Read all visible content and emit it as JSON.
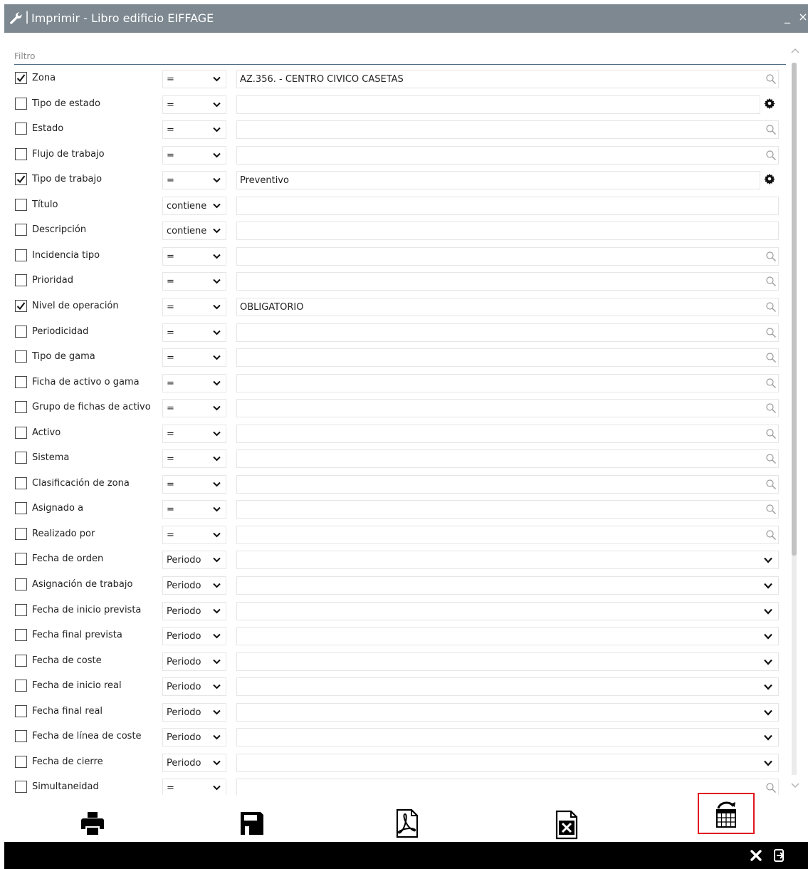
{
  "window": {
    "title": "Imprimir -  Libro edificio EIFFAGE",
    "separator": "|",
    "minimize_label": "_",
    "close_label": "×"
  },
  "filter": {
    "section_label": "Filtro",
    "rows": [
      {
        "label": "Zona",
        "checked": true,
        "operator": "=",
        "value": "AZ.356. - CENTRO CIVICO CASETAS",
        "action": "search-icon"
      },
      {
        "label": "Tipo de estado",
        "checked": false,
        "operator": "=",
        "value": "",
        "action": "gear-icon"
      },
      {
        "label": "Estado",
        "checked": false,
        "operator": "=",
        "value": "",
        "action": "search-icon"
      },
      {
        "label": "Flujo de trabajo",
        "checked": false,
        "operator": "=",
        "value": "",
        "action": "search-icon"
      },
      {
        "label": "Tipo de trabajo",
        "checked": true,
        "operator": "=",
        "value": "Preventivo",
        "action": "gear-icon"
      },
      {
        "label": "Título",
        "checked": false,
        "operator": "contiene",
        "value": "",
        "action": "none"
      },
      {
        "label": "Descripción",
        "checked": false,
        "operator": "contiene",
        "value": "",
        "action": "none"
      },
      {
        "label": "Incidencia tipo",
        "checked": false,
        "operator": "=",
        "value": "",
        "action": "search-icon"
      },
      {
        "label": "Prioridad",
        "checked": false,
        "operator": "=",
        "value": "",
        "action": "search-icon"
      },
      {
        "label": "Nivel de operación",
        "checked": true,
        "operator": "=",
        "value": "OBLIGATORIO",
        "action": "search-icon"
      },
      {
        "label": "Periodicidad",
        "checked": false,
        "operator": "=",
        "value": "",
        "action": "search-icon"
      },
      {
        "label": "Tipo de gama",
        "checked": false,
        "operator": "=",
        "value": "",
        "action": "search-icon"
      },
      {
        "label": "Ficha de activo o gama",
        "checked": false,
        "operator": "=",
        "value": "",
        "action": "search-icon"
      },
      {
        "label": "Grupo de fichas de activo",
        "checked": false,
        "operator": "=",
        "value": "",
        "action": "search-icon"
      },
      {
        "label": "Activo",
        "checked": false,
        "operator": "=",
        "value": "",
        "action": "search-icon"
      },
      {
        "label": "Sistema",
        "checked": false,
        "operator": "=",
        "value": "",
        "action": "search-icon"
      },
      {
        "label": "Clasificación de zona",
        "checked": false,
        "operator": "=",
        "value": "",
        "action": "search-icon"
      },
      {
        "label": "Asignado a",
        "checked": false,
        "operator": "=",
        "value": "",
        "action": "search-icon"
      },
      {
        "label": "Realizado por",
        "checked": false,
        "operator": "=",
        "value": "",
        "action": "search-icon"
      },
      {
        "label": "Fecha de orden",
        "checked": false,
        "operator": "Periodo",
        "value": "",
        "action": "chevron-down-icon"
      },
      {
        "label": "Asignación de trabajo",
        "checked": false,
        "operator": "Periodo",
        "value": "",
        "action": "chevron-down-icon"
      },
      {
        "label": "Fecha de inicio prevista",
        "checked": false,
        "operator": "Periodo",
        "value": "",
        "action": "chevron-down-icon"
      },
      {
        "label": "Fecha final prevista",
        "checked": false,
        "operator": "Periodo",
        "value": "",
        "action": "chevron-down-icon"
      },
      {
        "label": "Fecha de coste",
        "checked": false,
        "operator": "Periodo",
        "value": "",
        "action": "chevron-down-icon"
      },
      {
        "label": "Fecha de inicio real",
        "checked": false,
        "operator": "Periodo",
        "value": "",
        "action": "chevron-down-icon"
      },
      {
        "label": "Fecha final real",
        "checked": false,
        "operator": "Periodo",
        "value": "",
        "action": "chevron-down-icon"
      },
      {
        "label": "Fecha de línea de coste",
        "checked": false,
        "operator": "Periodo",
        "value": "",
        "action": "chevron-down-icon"
      },
      {
        "label": "Fecha de cierre",
        "checked": false,
        "operator": "Periodo",
        "value": "",
        "action": "chevron-down-icon"
      },
      {
        "label": "Simultaneidad",
        "checked": false,
        "operator": "=",
        "value": "",
        "action": "search-icon"
      }
    ]
  },
  "toolbar": {
    "buttons": [
      {
        "name": "print-button",
        "icon": "printer-icon"
      },
      {
        "name": "save-button",
        "icon": "floppy-disk-icon"
      },
      {
        "name": "export-pdf-button",
        "icon": "pdf-file-icon"
      },
      {
        "name": "export-excel-button",
        "icon": "excel-file-icon"
      },
      {
        "name": "schedule-button",
        "icon": "calendar-refresh-icon",
        "highlighted": true
      }
    ]
  },
  "footer": {
    "buttons": [
      {
        "name": "footer-close-button",
        "icon": "close-icon"
      },
      {
        "name": "footer-exit-button",
        "icon": "exit-icon"
      }
    ]
  },
  "colors": {
    "titlebar": "#7d8890",
    "section_line": "#4f6d85",
    "highlight_border": "#e0141e",
    "footer": "#000000",
    "scroll_thumb": "#c2c2c2"
  }
}
